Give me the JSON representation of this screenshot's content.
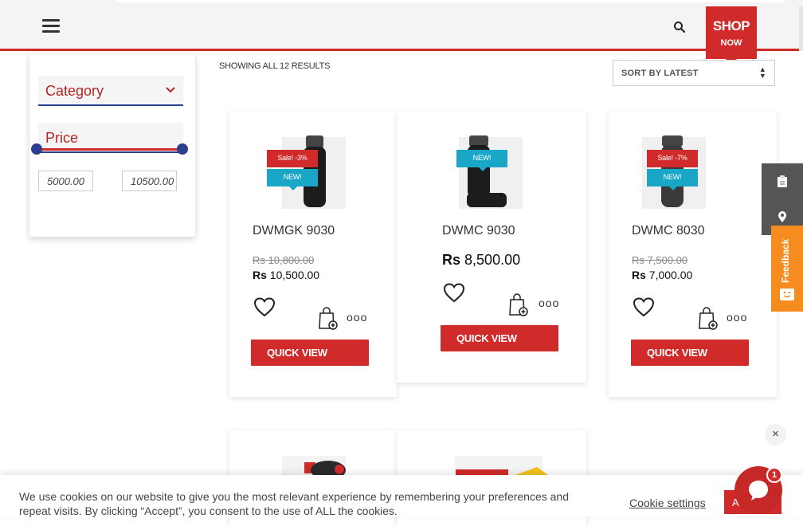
{
  "header": {
    "menu_icon": "hamburger-menu-icon",
    "search_icon": "search-icon",
    "shop_badge": {
      "line1": "SHOP",
      "line2": "NOW"
    }
  },
  "filters": {
    "category_label": "Category",
    "price_label": "Price",
    "price_min": "5000.00",
    "price_max": "10500.00"
  },
  "results_text": "SHOWING ALL 12 RESULTS",
  "sort": {
    "selected": "SORT BY LATEST"
  },
  "products": [
    {
      "name": "DWMGK 9030",
      "sale_badge": "Sale! -3%",
      "new_badge": "NEW!",
      "currency": "Rs",
      "old_price": "10,800.00",
      "price": "10,500.00",
      "action": "QUICK VIEW"
    },
    {
      "name": "DWMC 9030",
      "new_badge": "NEW!",
      "currency": "Rs",
      "price": "8,500.00",
      "action": "QUICK VIEW"
    },
    {
      "name": "DWMC 8030",
      "sale_badge": "Sale! -7%",
      "new_badge": "NEW!",
      "currency": "Rs",
      "old_price": "7,500.00",
      "price": "7,000.00",
      "action": "QUICK VIEW"
    }
  ],
  "more_icon_text": "ooo",
  "feedback_label": "Feedback",
  "cookie": {
    "text": "We use cookies on our website to give you the most relevant experience by remembering your preferences and repeat visits. By clicking “Accept”, you consent to the use of ALL the cookies.",
    "settings_label": "Cookie settings",
    "accept_label": "Accept"
  },
  "chat": {
    "unread_count": "1",
    "close_label": "×"
  },
  "colors": {
    "brand_red": "#d12a2a",
    "accent_blue": "#2c3e8f",
    "new_badge": "#1aa6c7",
    "feedback": "#f68b1f"
  }
}
